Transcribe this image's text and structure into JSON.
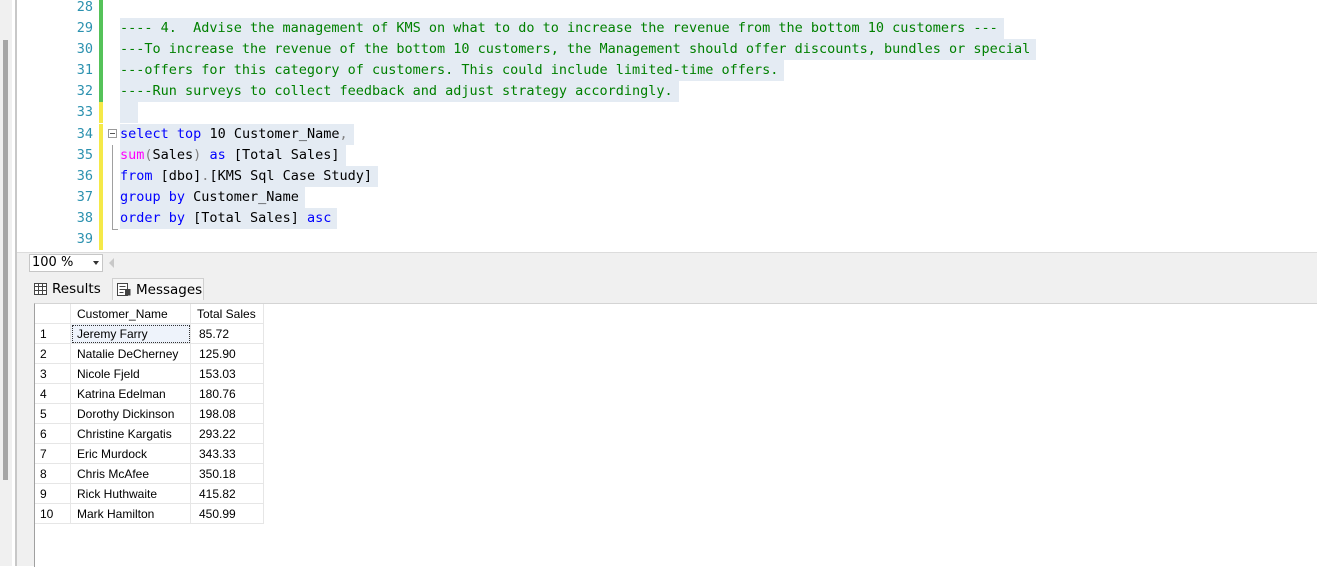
{
  "editor": {
    "lines": [
      {
        "num": "28",
        "change": "saved"
      },
      {
        "num": "29",
        "change": "saved"
      },
      {
        "num": "30",
        "change": "saved"
      },
      {
        "num": "31",
        "change": "saved"
      },
      {
        "num": "32",
        "change": "saved"
      },
      {
        "num": "33",
        "change": "unsaved"
      },
      {
        "num": "34",
        "change": "unsaved"
      },
      {
        "num": "35",
        "change": "unsaved"
      },
      {
        "num": "36",
        "change": "unsaved"
      },
      {
        "num": "37",
        "change": "unsaved"
      },
      {
        "num": "38",
        "change": "unsaved"
      },
      {
        "num": "39",
        "change": "unsaved"
      }
    ],
    "comments": {
      "c29": "---- 4.  Advise the management of KMS on what to do to increase the revenue from the bottom 10 customers ---",
      "c30": "---To increase the revenue of the bottom 10 customers, the Management should offer discounts, bundles or special",
      "c31": "---offers for this category of customers. This could include limited-time offers.",
      "c32": "----Run surveys to collect feedback and adjust strategy accordingly."
    },
    "sql": {
      "kw_select": "select",
      "kw_top": "top",
      "top_n": " 10 Customer_Name",
      "comma": ",",
      "fn_sum": "sum",
      "paren_open": "(",
      "sales": "Sales",
      "paren_close": ")",
      "kw_as": "as",
      "alias": " [Total Sales]",
      "kw_from": "from",
      "schema": " [dbo]",
      "dot": ".",
      "table": "[KMS Sql Case Study]",
      "kw_group_by": "group by",
      "group_col": " Customer_Name",
      "kw_order_by": "order by",
      "order_col": " [Total Sales] ",
      "kw_asc": "asc"
    }
  },
  "zoom": {
    "value": "100 %"
  },
  "tabs": {
    "results": "Results",
    "messages": "Messages"
  },
  "grid": {
    "columns": [
      "Customer_Name",
      "Total Sales"
    ],
    "rows": [
      {
        "n": "1",
        "name": "Jeremy Farry",
        "sales": "85.72"
      },
      {
        "n": "2",
        "name": "Natalie DeCherney",
        "sales": "125.90"
      },
      {
        "n": "3",
        "name": "Nicole Fjeld",
        "sales": "153.03"
      },
      {
        "n": "4",
        "name": "Katrina Edelman",
        "sales": "180.76"
      },
      {
        "n": "5",
        "name": "Dorothy Dickinson",
        "sales": "198.08"
      },
      {
        "n": "6",
        "name": "Christine Kargatis",
        "sales": "293.22"
      },
      {
        "n": "7",
        "name": "Eric Murdock",
        "sales": "343.33"
      },
      {
        "n": "8",
        "name": "Chris McAfee",
        "sales": "350.18"
      },
      {
        "n": "9",
        "name": "Rick Huthwaite",
        "sales": "415.82"
      },
      {
        "n": "10",
        "name": "Mark Hamilton",
        "sales": "450.99"
      }
    ]
  },
  "colors": {
    "keyword": "#0000ff",
    "function": "#ff00ff",
    "comment": "#008000",
    "line_number": "#2b91af"
  },
  "icons": {
    "results_tab": "grid-icon",
    "messages_tab": "messages-icon"
  }
}
